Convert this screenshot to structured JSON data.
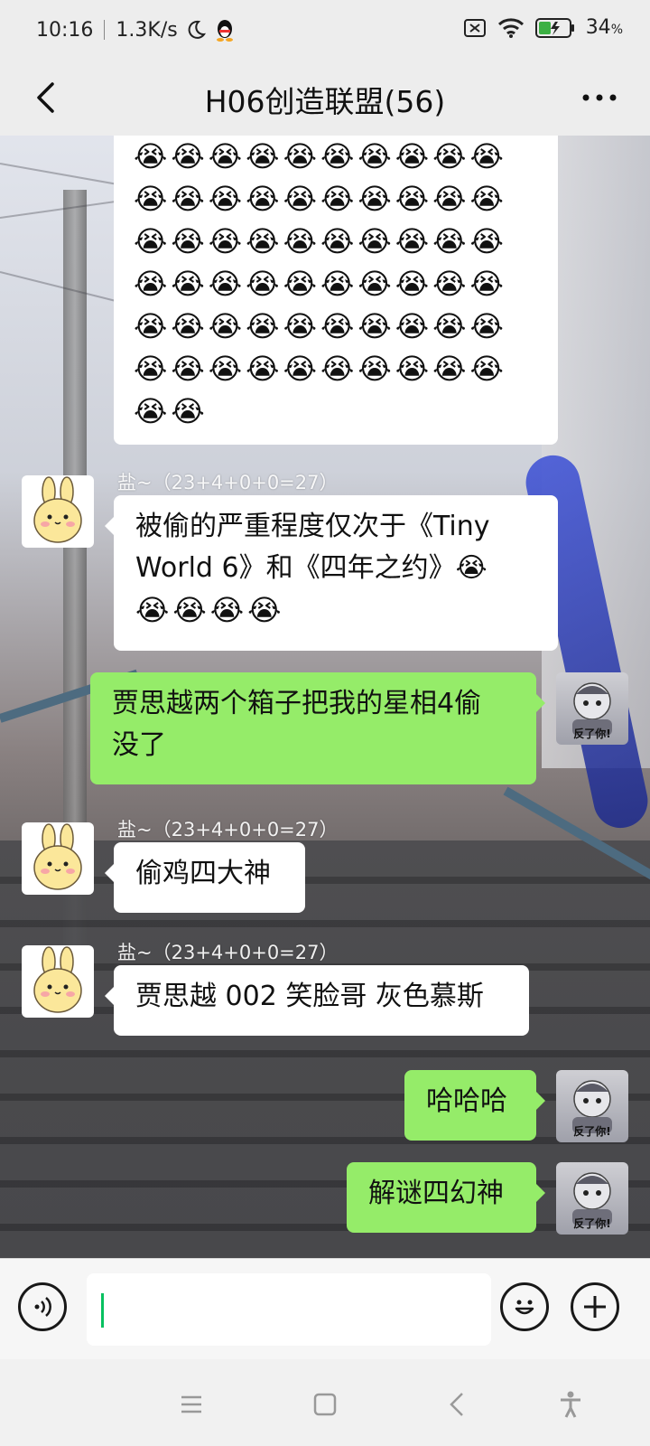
{
  "status_bar": {
    "time": "10:16",
    "speed": "1.3K/s",
    "battery": "34",
    "battery_unit": "%"
  },
  "header": {
    "title": "H06创造联盟(56)",
    "back_icon": "chevron-left-icon",
    "more_icon": "more-dots-icon"
  },
  "messages": [
    {
      "side": "left",
      "type": "emoji-block",
      "rows": [
        "😭😭😭😭😭😭😭😭😭😭",
        "😭😭😭😭😭😭😭😭😭😭",
        "😭😭😭😭😭😭😭😭😭😭",
        "😭😭😭😭😭😭😭😭😭😭",
        "😭😭😭😭😭😭😭😭😭😭",
        "😭😭😭😭😭😭😭😭😭😭",
        "😭😭"
      ]
    },
    {
      "side": "left",
      "sender": "盐~（23+4+0+0=27）",
      "line1": "被偷的严重程度仅次于《Tiny",
      "line2": "World 6》和《四年之约》😭",
      "line3": "😭😭😭😭"
    },
    {
      "side": "right",
      "line1": "贾思越两个箱子把我的星相4偷",
      "line2": "没了"
    },
    {
      "side": "left",
      "sender": "盐~（23+4+0+0=27）",
      "text": "偷鸡四大神"
    },
    {
      "side": "left",
      "sender": "盐~（23+4+0+0=27）",
      "text": "贾思越 002 笑脸哥 灰色慕斯"
    },
    {
      "side": "right",
      "text": "哈哈哈"
    },
    {
      "side": "right",
      "text": "解谜四幻神"
    }
  ],
  "avatar_caption": "反了你!",
  "input_bar": {
    "value": "",
    "voice_icon": "voice-icon",
    "emoji_icon": "smiley-icon",
    "plus_icon": "plus-icon"
  },
  "nav_bar": {
    "menu_icon": "menu-icon",
    "home_icon": "home-square-icon",
    "back_icon": "back-triangle-icon",
    "accessibility_icon": "accessibility-icon"
  }
}
